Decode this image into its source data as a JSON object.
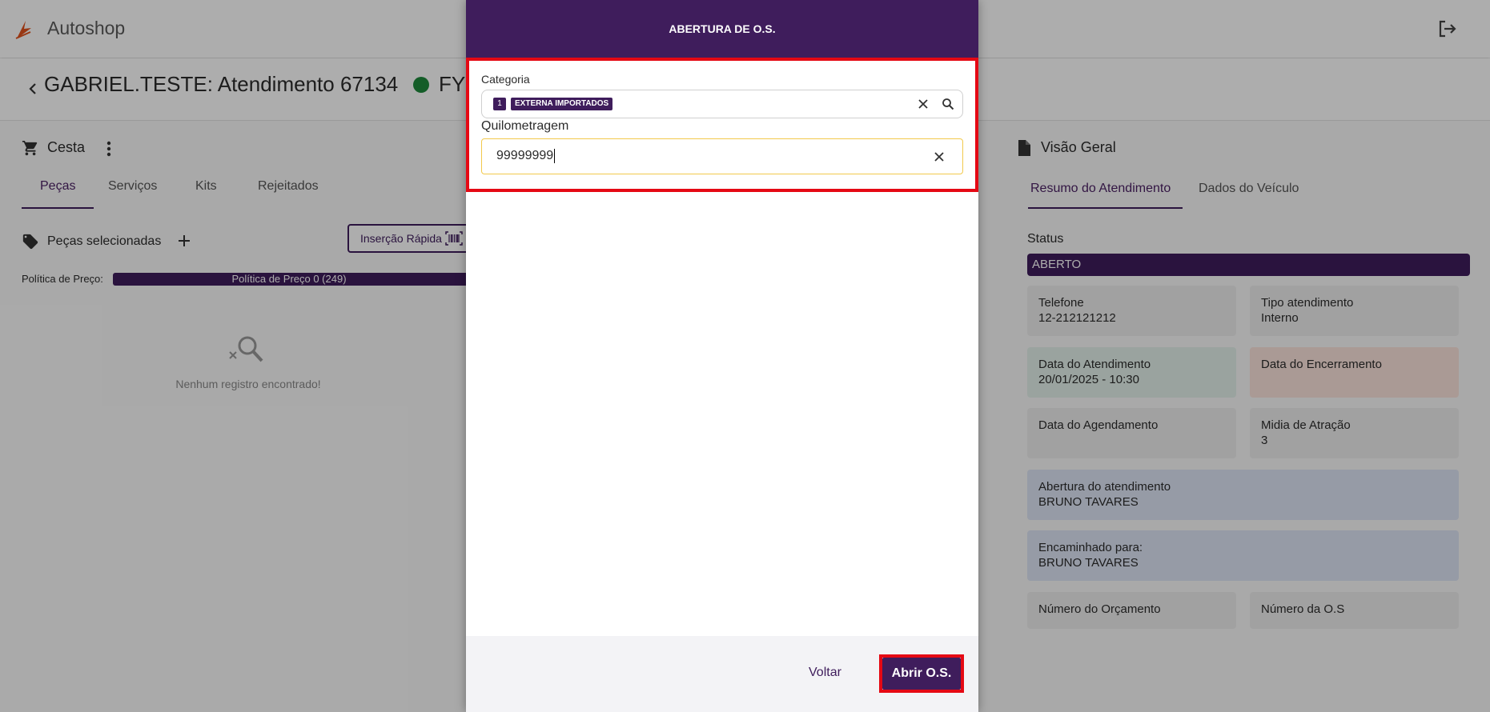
{
  "app": {
    "title": "Autoshop"
  },
  "header": {
    "title": "GABRIEL.TESTE: Atendimento 67134",
    "title_suffix": "FY"
  },
  "left_panel": {
    "title": "Cesta",
    "tabs": [
      {
        "label": "Peças"
      },
      {
        "label": "Serviços"
      },
      {
        "label": "Kits"
      },
      {
        "label": "Rejeitados"
      }
    ],
    "section_title": "Peças selecionadas",
    "quick_insert_label": "Inserção Rápida",
    "price_policy_label": "Política de Preço:",
    "price_policy_value": "Política de Preço 0 (249)",
    "empty_text": "Nenhum registro encontrado!"
  },
  "right_panel": {
    "title": "Visão Geral",
    "tabs": [
      {
        "label": "Resumo do Atendimento"
      },
      {
        "label": "Dados do Veículo"
      }
    ],
    "status_label": "Status",
    "status_value": "ABERTO",
    "cards": [
      {
        "label": "Telefone",
        "value": "12-212121212"
      },
      {
        "label": "Tipo atendimento",
        "value": "Interno"
      },
      {
        "label": "Data do Atendimento",
        "value": "20/01/2025 - 10:30"
      },
      {
        "label": "Data do Encerramento",
        "value": ""
      },
      {
        "label": "Data do Agendamento",
        "value": ""
      },
      {
        "label": "Midia de Atração",
        "value": "3"
      },
      {
        "label": "Abertura do atendimento",
        "value": "BRUNO TAVARES"
      },
      {
        "label": "Encaminhado para:",
        "value": "BRUNO TAVARES"
      },
      {
        "label": "Número do Orçamento",
        "value": ""
      },
      {
        "label": "Número da O.S",
        "value": ""
      }
    ]
  },
  "dialog": {
    "title": "ABERTURA DE O.S.",
    "category_label": "Categoria",
    "category_chip_number": "1",
    "category_chip_text": "EXTERNA IMPORTADOS",
    "km_label": "Quilometragem",
    "km_value": "99999999",
    "back_label": "Voltar",
    "open_label": "Abrir O.S."
  },
  "colors": {
    "brand_purple": "#3f1d5c",
    "highlight_red": "#e50914",
    "status_green": "#1e8a3c",
    "input_focus_yellow": "#f2c94c"
  },
  "icons": [
    "logo-icon",
    "logout-icon",
    "back-icon",
    "cart-icon",
    "kebab-icon",
    "tag-icon",
    "add-icon",
    "barcode-icon",
    "empty-search-icon",
    "document-icon",
    "clear-icon",
    "search-icon"
  ]
}
